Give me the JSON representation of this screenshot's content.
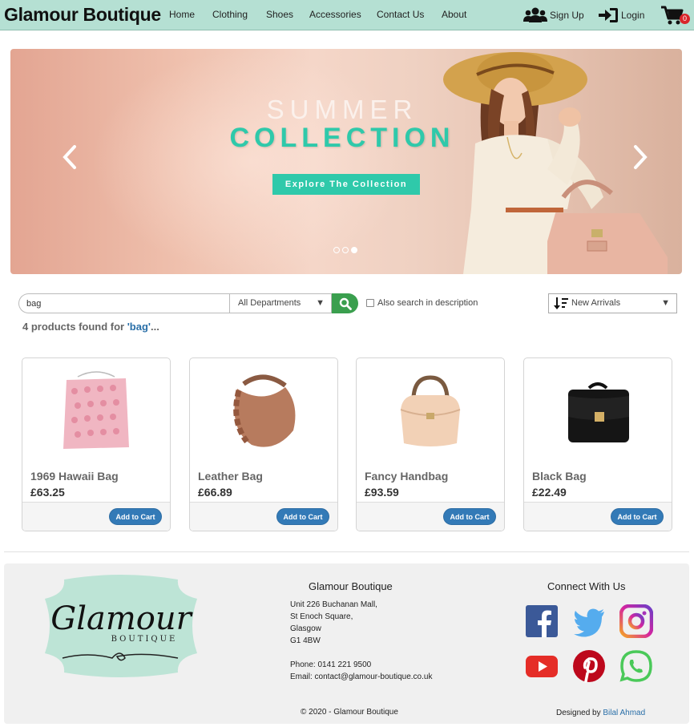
{
  "nav": {
    "brand": "Glamour Boutique",
    "links": [
      "Home",
      "Clothing",
      "Shoes",
      "Accessories",
      "Contact Us",
      "About"
    ],
    "signup": "Sign Up",
    "login": "Login",
    "cart_count": "0"
  },
  "hero": {
    "line1": "SUMMER",
    "line2": "COLLECTION",
    "button": "Explore The Collection",
    "slides": 3,
    "active_slide": 3
  },
  "search": {
    "value": "bag",
    "department": "All Departments",
    "also_search_label": "Also search in description",
    "sort": "New Arrivals",
    "found_prefix": "4 products found for ",
    "found_query": "'bag'",
    "found_suffix": "..."
  },
  "products": [
    {
      "name": "1969 Hawaii Bag",
      "price": "£63.25",
      "button": "Add to Cart"
    },
    {
      "name": "Leather Bag",
      "price": "£66.89",
      "button": "Add to Cart"
    },
    {
      "name": "Fancy Handbag",
      "price": "£93.59",
      "button": "Add to Cart"
    },
    {
      "name": "Black Bag",
      "price": "£22.49",
      "button": "Add to Cart"
    }
  ],
  "footer": {
    "logo_text": "Glamour",
    "logo_sub": "BOUTIQUE",
    "title": "Glamour Boutique",
    "address": [
      "Unit 226 Buchanan Mall,",
      "St Enoch Square,",
      "Glasgow",
      "G1 4BW"
    ],
    "phone": "Phone: 0141 221 9500",
    "email": "Email: contact@glamour-boutique.co.uk",
    "connect": "Connect With Us",
    "copyright": "© 2020 - Glamour Boutique",
    "designed_by": "Designed by",
    "designer": "Bilal Ahmad"
  },
  "colors": {
    "nav_bg": "#b5e0d3",
    "accent": "#2fc9aa",
    "button_blue": "#337ab7",
    "search_green": "#3a9f4e"
  }
}
